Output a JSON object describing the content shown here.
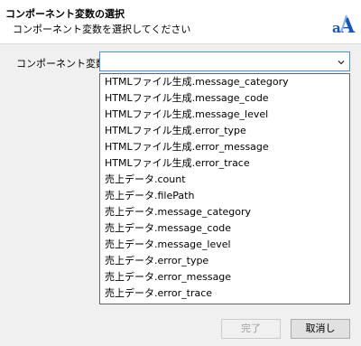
{
  "header": {
    "title": "コンポーネント変数の選択",
    "subtitle": "コンポーネント変数を選択してください",
    "logo_text": "aA",
    "logo_colors": {
      "primary": "#1a56b8",
      "secondary": "#7fb0ef"
    }
  },
  "form": {
    "label": "コンポーネント変数",
    "selected_value": "",
    "accent_color": "#4a90d9"
  },
  "options": [
    "HTMLファイル生成.message_category",
    "HTMLファイル生成.message_code",
    "HTMLファイル生成.message_level",
    "HTMLファイル生成.error_type",
    "HTMLファイル生成.error_message",
    "HTMLファイル生成.error_trace",
    "売上データ.count",
    "売上データ.filePath",
    "売上データ.message_category",
    "売上データ.message_code",
    "売上データ.message_level",
    "売上データ.error_type",
    "売上データ.error_message",
    "売上データ.error_trace"
  ],
  "buttons": {
    "ok_label": "完了",
    "ok_enabled": false,
    "cancel_label": "取消し"
  }
}
